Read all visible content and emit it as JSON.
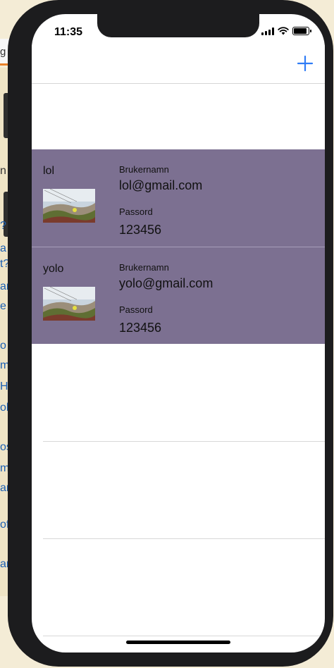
{
  "background": {
    "tab_fragment": "g",
    "words": [
      "n",
      "?",
      "a",
      "t?",
      "ar",
      "e",
      "o",
      "m",
      "H",
      "ol",
      "os",
      "m",
      "ar",
      "of",
      "ar"
    ]
  },
  "status_bar": {
    "time": "11:35",
    "icons": [
      "cellular-signal-icon",
      "wifi-icon",
      "battery-icon"
    ],
    "battery_level": 0.9
  },
  "nav_bar": {
    "add_button_icon": "plus-icon",
    "accent_color": "#2f7cf6"
  },
  "accounts": [
    {
      "name": "lol",
      "thumbnail_icon": "landscape-photo-thumbnail",
      "username_label": "Brukernamn",
      "username": "lol@gmail.com",
      "password_label": "Passord",
      "password": "123456"
    },
    {
      "name": "yolo",
      "thumbnail_icon": "landscape-photo-thumbnail",
      "username_label": "Brukernamn",
      "username": "yolo@gmail.com",
      "password_label": "Passord",
      "password": "123456"
    }
  ],
  "colors": {
    "row_background": "#7c7091",
    "separator": "#d8d8d8"
  }
}
